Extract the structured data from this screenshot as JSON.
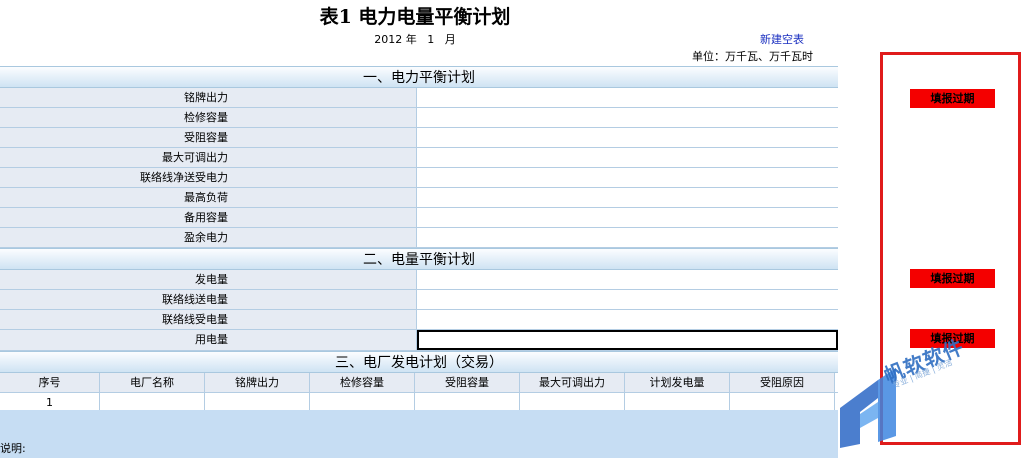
{
  "title": "表1  电力电量平衡计划",
  "date": {
    "year": "2012",
    "year_unit": "年",
    "month": "1",
    "month_unit": "月"
  },
  "new_blank_link": "新建空表",
  "unit_label": "单位：万千瓦、万千瓦时",
  "section_power": {
    "title": "一、电力平衡计划",
    "rows": [
      "铭牌出力",
      "检修容量",
      "受阻容量",
      "最大可调出力",
      "联络线净送受电力",
      "最高负荷",
      "备用容量",
      "盈余电力"
    ]
  },
  "section_energy": {
    "title": "二、电量平衡计划",
    "rows": [
      "发电量",
      "联络线送电量",
      "联络线受电量",
      "用电量"
    ]
  },
  "section_plant": {
    "title": "三、电厂发电计划（交易）",
    "headers": [
      "序号",
      "电厂名称",
      "铭牌出力",
      "检修容量",
      "受阻容量",
      "最大可调出力",
      "计划发电量",
      "受阻原因"
    ],
    "rows": [
      [
        "1",
        "",
        "",
        "",
        "",
        "",
        "",
        ""
      ]
    ]
  },
  "notes_label": "说明:",
  "overdue_label": "填报过期",
  "logo": {
    "name": "帆软软件",
    "tagline": "专业 | 简捷 | 灵活"
  },
  "colors": {
    "accent_red": "#f40000",
    "panel_border": "#e01b1b",
    "label_bg": "#e6ebf3",
    "link": "#1a2fc0"
  }
}
